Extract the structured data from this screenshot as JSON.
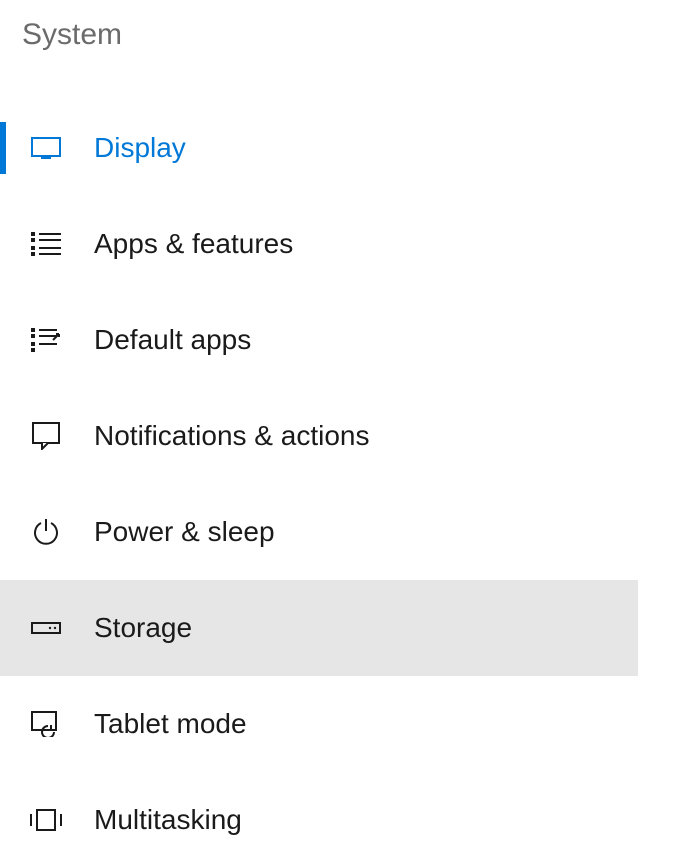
{
  "header": {
    "title": "System"
  },
  "nav": {
    "items": [
      {
        "label": "Display"
      },
      {
        "label": "Apps & features"
      },
      {
        "label": "Default apps"
      },
      {
        "label": "Notifications & actions"
      },
      {
        "label": "Power & sleep"
      },
      {
        "label": "Storage"
      },
      {
        "label": "Tablet mode"
      },
      {
        "label": "Multitasking"
      }
    ]
  },
  "state": {
    "selected_index": 0,
    "hover_index": 5
  },
  "colors": {
    "accent": "#0078d7",
    "hover_bg": "#e6e6e6",
    "text": "#1a1a1a",
    "header_text": "#6b6b6b"
  }
}
